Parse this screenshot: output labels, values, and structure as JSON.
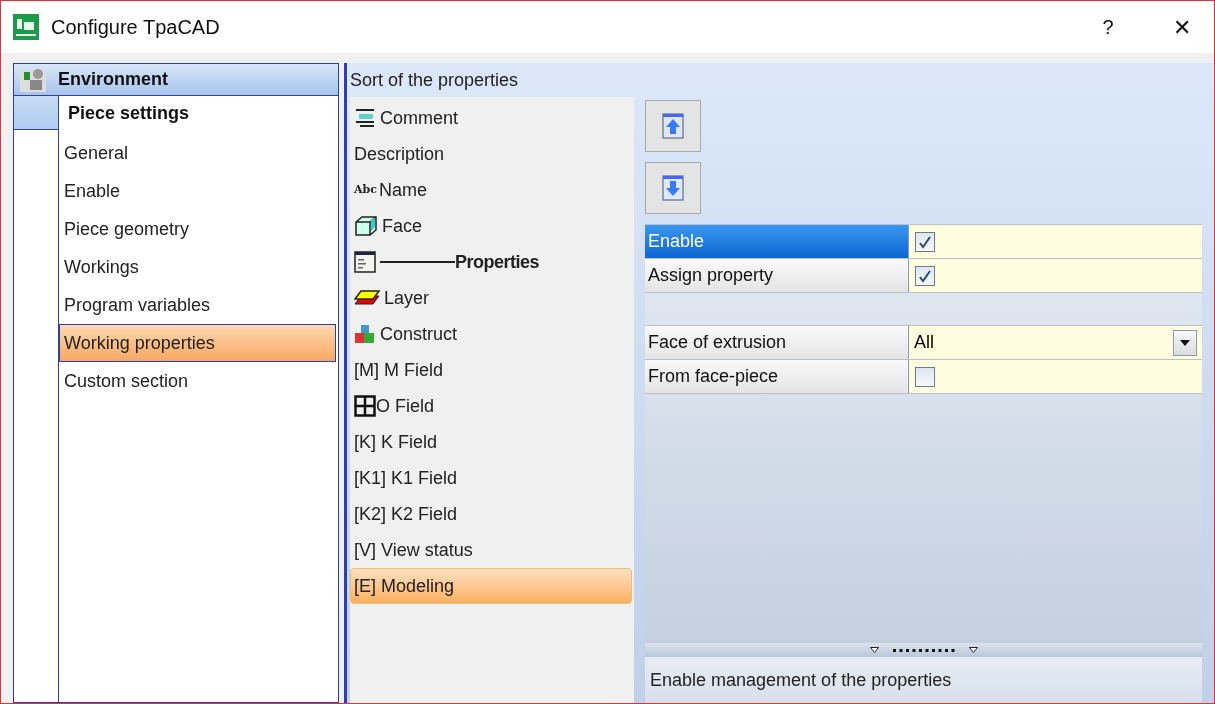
{
  "window": {
    "title": "Configure TpaCAD",
    "help": "?",
    "close": "✕"
  },
  "sidebar": {
    "header": "Environment",
    "section": "Piece settings",
    "items": [
      {
        "label": "General",
        "selected": false
      },
      {
        "label": "Enable",
        "selected": false
      },
      {
        "label": "Piece geometry",
        "selected": false
      },
      {
        "label": "Workings",
        "selected": false
      },
      {
        "label": "Program variables",
        "selected": false
      },
      {
        "label": "Working properties",
        "selected": true
      },
      {
        "label": "Custom section",
        "selected": false
      }
    ]
  },
  "panel": {
    "title": "Sort of the properties"
  },
  "sort_list": [
    {
      "kind": "comment",
      "label": "Comment",
      "selected": false
    },
    {
      "kind": "plain",
      "label": "Description",
      "selected": false
    },
    {
      "kind": "name",
      "glyph": "Abc",
      "label": "Name",
      "selected": false
    },
    {
      "kind": "face",
      "label": "Face",
      "selected": false
    },
    {
      "kind": "group",
      "label": "Properties",
      "selected": false
    },
    {
      "kind": "layer",
      "label": "Layer",
      "selected": false
    },
    {
      "kind": "construct",
      "label": "Construct",
      "selected": false
    },
    {
      "kind": "plain",
      "label": "[M] M Field",
      "selected": false
    },
    {
      "kind": "grid",
      "label": "O Field",
      "selected": false
    },
    {
      "kind": "plain",
      "label": "[K] K Field",
      "selected": false
    },
    {
      "kind": "plain",
      "label": "[K1] K1 Field",
      "selected": false
    },
    {
      "kind": "plain",
      "label": "[K2] K2 Field",
      "selected": false
    },
    {
      "kind": "plain",
      "label": "[V] View status",
      "selected": false
    },
    {
      "kind": "plain",
      "label": "[E] Modeling",
      "selected": true
    }
  ],
  "property_groups": [
    [
      {
        "kind": "checkbox",
        "label": "Enable",
        "checked": true,
        "selected": true
      },
      {
        "kind": "checkbox",
        "label": "Assign property",
        "checked": true,
        "selected": false
      }
    ],
    [
      {
        "kind": "dropdown",
        "label": "Face of extrusion",
        "value": "All",
        "selected": false
      },
      {
        "kind": "checkbox",
        "label": "From face-piece",
        "checked": false,
        "selected": false
      }
    ]
  ],
  "description": "Enable management of the properties"
}
